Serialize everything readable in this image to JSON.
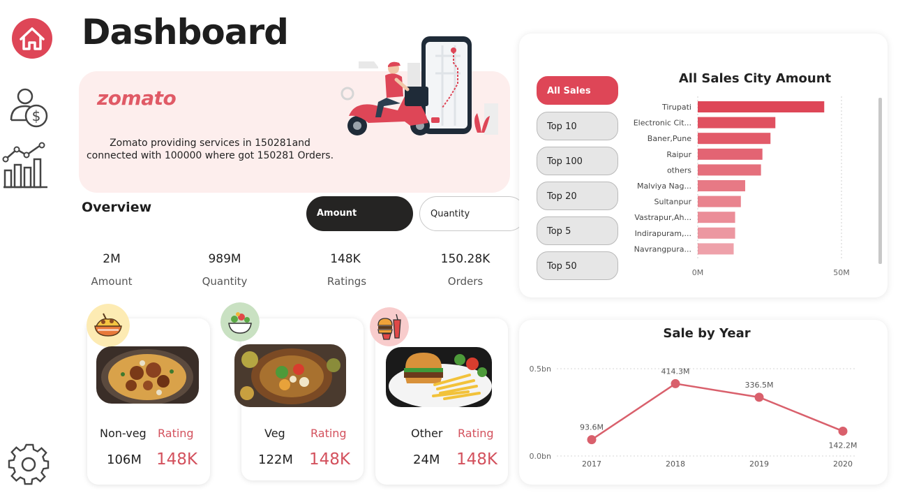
{
  "sidebar": {
    "items": [
      {
        "icon": "home-icon",
        "active": true
      },
      {
        "icon": "user-money-icon"
      },
      {
        "icon": "bar-line-chart-icon"
      },
      {
        "icon": "gear-icon"
      }
    ],
    "accent": "#de4657"
  },
  "page": {
    "title": "Dashboard"
  },
  "banner": {
    "brand": "zomato",
    "line1": "Zomato providing services in 150281and",
    "line2": "connected with 100000 where got 150281 Orders."
  },
  "overview": {
    "title": "Overview",
    "toggle_amount": "Amount",
    "toggle_quantity": "Quantity",
    "kpis": [
      {
        "value": "2M",
        "label": "Amount"
      },
      {
        "value": "989M",
        "label": "Quantity"
      },
      {
        "value": "148K",
        "label": "Ratings"
      },
      {
        "value": "150.28K",
        "label": "Orders"
      }
    ]
  },
  "food_cards": [
    {
      "name": "Non-veg",
      "rating_label": "Rating",
      "value": "106M",
      "rating": "148K",
      "icon": "biryani-bowl-icon"
    },
    {
      "name": "Veg",
      "rating_label": "Rating",
      "value": "122M",
      "rating": "148K",
      "icon": "salad-bowl-icon"
    },
    {
      "name": "Other",
      "rating_label": "Rating",
      "value": "24M",
      "rating": "148K",
      "icon": "fast-food-icon"
    }
  ],
  "filters": [
    "All Sales",
    "Top 10",
    "Top 100",
    "Top 20",
    "Top 5",
    "Top 50"
  ],
  "charts": [
    {
      "type": "bar",
      "title": "All Sales City Amount",
      "categories": [
        "Tirupati",
        "Electronic Cit...",
        "Baner,Pune",
        "Raipur",
        "others",
        "Malviya Nag...",
        "Sultanpur",
        "Vastrapur,Ah...",
        "Indirapuram,...",
        "Navrangpura..."
      ],
      "values": [
        44,
        27,
        25.3,
        22.5,
        22,
        16.5,
        15,
        13,
        13,
        12.5
      ],
      "xlim": [
        0,
        50
      ],
      "xticks": [
        "0M",
        "50M"
      ],
      "color": "#de4657"
    },
    {
      "type": "line",
      "title": "Sale by Year",
      "x": [
        "2017",
        "2018",
        "2019",
        "2020"
      ],
      "values": [
        93.6,
        414.3,
        336.5,
        142.2
      ],
      "labels": [
        "93.6M",
        "414.3M",
        "336.5M",
        "142.2M"
      ],
      "ylim": [
        0,
        500
      ],
      "yticks": [
        "0.0bn",
        "0.5bn"
      ],
      "color": "#d9606c"
    }
  ]
}
